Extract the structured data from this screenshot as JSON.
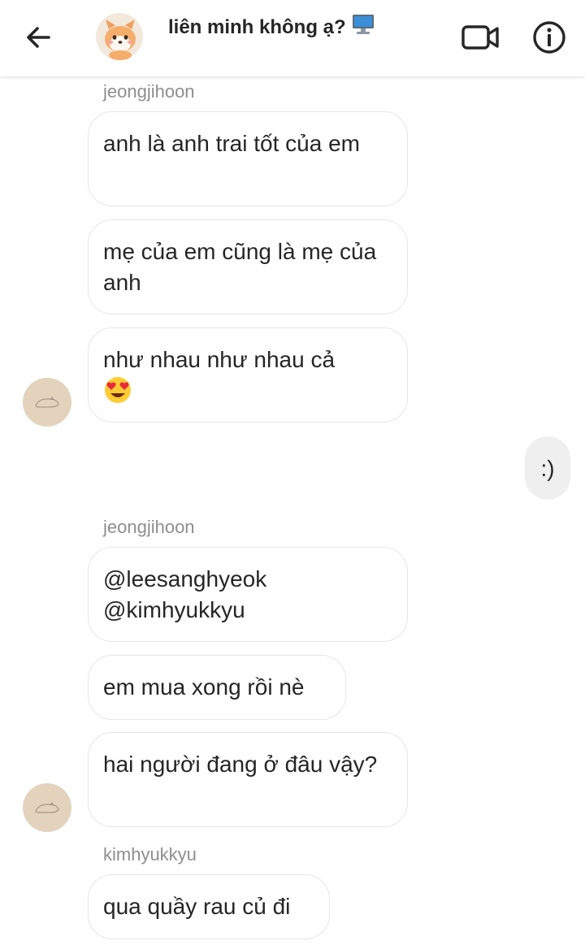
{
  "header": {
    "title": "liên minh không ạ?",
    "title_emoji": "desktop-computer-emoji",
    "back_icon": "arrow-left-icon",
    "video_icon": "video-camera-icon",
    "info_icon": "info-icon"
  },
  "messages": [
    {
      "sender": "jeongjihoon"
    },
    {
      "text": "anh là anh trai tốt của em"
    },
    {
      "text": "mẹ của em cũng là mẹ của anh"
    },
    {
      "text": "như nhau như nhau cả",
      "emoji": "heart-eyes-emoji"
    },
    {
      "text": ":)"
    },
    {
      "sender": "jeongjihoon"
    },
    {
      "text": "@leesanghyeok @kimhyukkyu"
    },
    {
      "text": "em mua xong rồi nè"
    },
    {
      "text": "hai người đang ở đâu vậy?"
    },
    {
      "sender": "kimhyukkyu"
    },
    {
      "text": "qua quầy rau củ đi"
    }
  ],
  "colors": {
    "incoming_bubble_border": "#e6e6e6",
    "outgoing_bubble_bg": "#efefef",
    "sender_name": "#8e8e8e",
    "avatar_bg": "#e3d3bd"
  }
}
